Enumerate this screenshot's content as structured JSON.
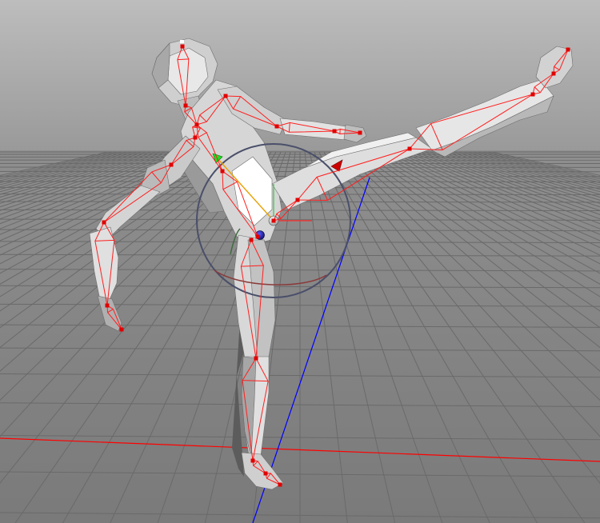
{
  "viewport": {
    "view": "perspective",
    "background_top": "#bdbdbd",
    "background_horizon": "#999999",
    "floor_color": "#7f7f7f",
    "grid_color": "#6a6a6a",
    "x_axis_color": "#ff0000",
    "z_axis_color": "#0000ff"
  },
  "character": {
    "mesh_light": "#eeeeee",
    "mesh_mid": "#c4c4c4",
    "mesh_dark": "#8a8a8a",
    "bone_color": "#ff1f1f",
    "bone_joint_color": "#e00000"
  },
  "manipulator": {
    "type": "rotate",
    "ring_color": "#4a4f6a",
    "x_ring_color": "#8b3a3a",
    "y_ring_color": "#3f6b3f",
    "pivot_color": "#1a1a8c",
    "center_color": "#ffffff"
  }
}
